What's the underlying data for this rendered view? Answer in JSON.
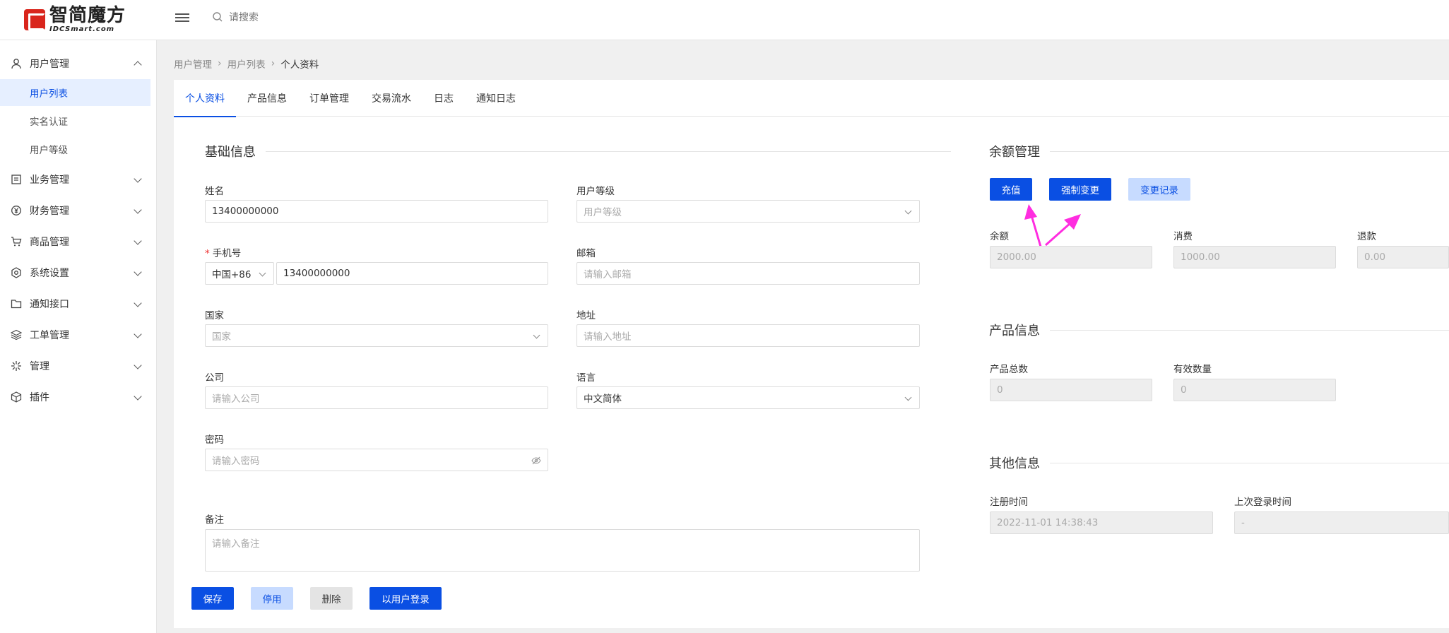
{
  "header": {
    "brand_cn": "智简魔方",
    "brand_en": "IDCSmart.com",
    "search_placeholder": "请搜索"
  },
  "sidebar": {
    "groups": [
      {
        "label": "用户管理",
        "icon": "user-icon",
        "expanded": true
      },
      {
        "label": "业务管理",
        "icon": "document-icon"
      },
      {
        "label": "财务管理",
        "icon": "yen-icon"
      },
      {
        "label": "商品管理",
        "icon": "cart-icon"
      },
      {
        "label": "系统设置",
        "icon": "gear-icon"
      },
      {
        "label": "通知接口",
        "icon": "folder-icon"
      },
      {
        "label": "工单管理",
        "icon": "layers-icon"
      },
      {
        "label": "管理",
        "icon": "sparkle-icon"
      },
      {
        "label": "插件",
        "icon": "cube-icon"
      }
    ],
    "sub_items": [
      "用户列表",
      "实名认证",
      "用户等级"
    ],
    "active_sub": "用户列表"
  },
  "breadcrumb": [
    "用户管理",
    "用户列表",
    "个人资料"
  ],
  "tabs": [
    "个人资料",
    "产品信息",
    "订单管理",
    "交易流水",
    "日志",
    "通知日志"
  ],
  "active_tab": "个人资料",
  "basic": {
    "title": "基础信息",
    "name_label": "姓名",
    "name_value": "13400000000",
    "level_label": "用户等级",
    "level_placeholder": "用户等级",
    "phone_label": "手机号",
    "phone_code": "中国+86",
    "phone_value": "13400000000",
    "email_label": "邮箱",
    "email_placeholder": "请输入邮箱",
    "country_label": "国家",
    "country_placeholder": "国家",
    "address_label": "地址",
    "address_placeholder": "请输入地址",
    "company_label": "公司",
    "company_placeholder": "请输入公司",
    "language_label": "语言",
    "language_value": "中文简体",
    "password_label": "密码",
    "password_placeholder": "请输入密码",
    "note_label": "备注",
    "note_placeholder": "请输入备注"
  },
  "actions": {
    "save": "保存",
    "disable": "停用",
    "delete": "删除",
    "login_as_user": "以用户登录"
  },
  "balance": {
    "title": "余额管理",
    "recharge": "充值",
    "force_change": "强制变更",
    "change_log": "变更记录",
    "balance_label": "余额",
    "balance_value": "2000.00",
    "consume_label": "消费",
    "consume_value": "1000.00",
    "refund_label": "退款",
    "refund_value": "0.00"
  },
  "product": {
    "title": "产品信息",
    "total_label": "产品总数",
    "total_value": "0",
    "valid_label": "有效数量",
    "valid_value": "0"
  },
  "other": {
    "title": "其他信息",
    "register_label": "注册时间",
    "register_value": "2022-11-01 14:38:43",
    "last_login_label": "上次登录时间",
    "last_login_value": "-"
  },
  "colors": {
    "primary": "#0a4fe3",
    "annotation_arrow": "#ff2de0"
  }
}
